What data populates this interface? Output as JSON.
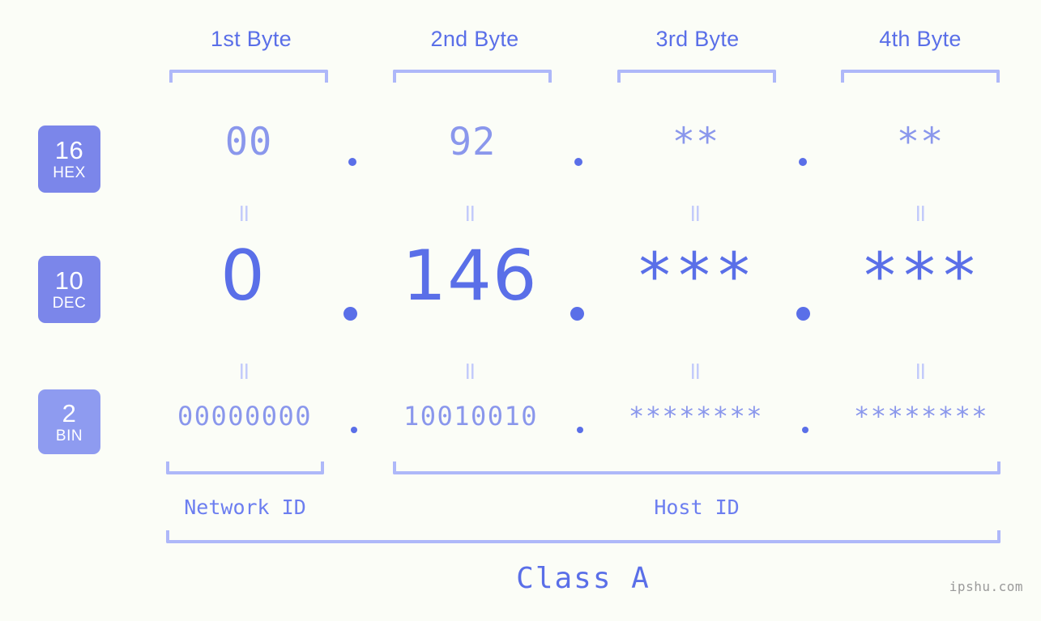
{
  "meta": {
    "background_color": "#fbfdf7",
    "accent_color": "#5a6fe8",
    "light_accent_color": "#8a97ec",
    "bracket_color": "#aeb8f9",
    "badge_color": "#7b86ea",
    "badge_bin_color": "#8e9bf0",
    "watermark": "ipshu.com"
  },
  "headers": {
    "bytes": [
      {
        "label": "1st Byte"
      },
      {
        "label": "2nd Byte"
      },
      {
        "label": "3rd Byte"
      },
      {
        "label": "4th Byte"
      }
    ]
  },
  "radix_badges": [
    {
      "number": "16",
      "name": "HEX"
    },
    {
      "number": "10",
      "name": "DEC"
    },
    {
      "number": "2",
      "name": "BIN"
    }
  ],
  "rows": {
    "hex": {
      "radix": "16",
      "radix_name": "HEX",
      "values": [
        "00",
        "92",
        "**",
        "**"
      ],
      "separator": "."
    },
    "dec": {
      "radix": "10",
      "radix_name": "DEC",
      "values": [
        "0",
        "146",
        "***",
        "***"
      ],
      "separator": "."
    },
    "bin": {
      "radix": "2",
      "radix_name": "BIN",
      "values": [
        "00000000",
        "10010010",
        "********",
        "********"
      ],
      "separator": "."
    }
  },
  "equals_marks": {
    "symbol": "=",
    "count_per_row": 4
  },
  "segments": {
    "network_id": {
      "label": "Network ID"
    },
    "host_id": {
      "label": "Host ID"
    }
  },
  "class": {
    "label": "Class A"
  }
}
